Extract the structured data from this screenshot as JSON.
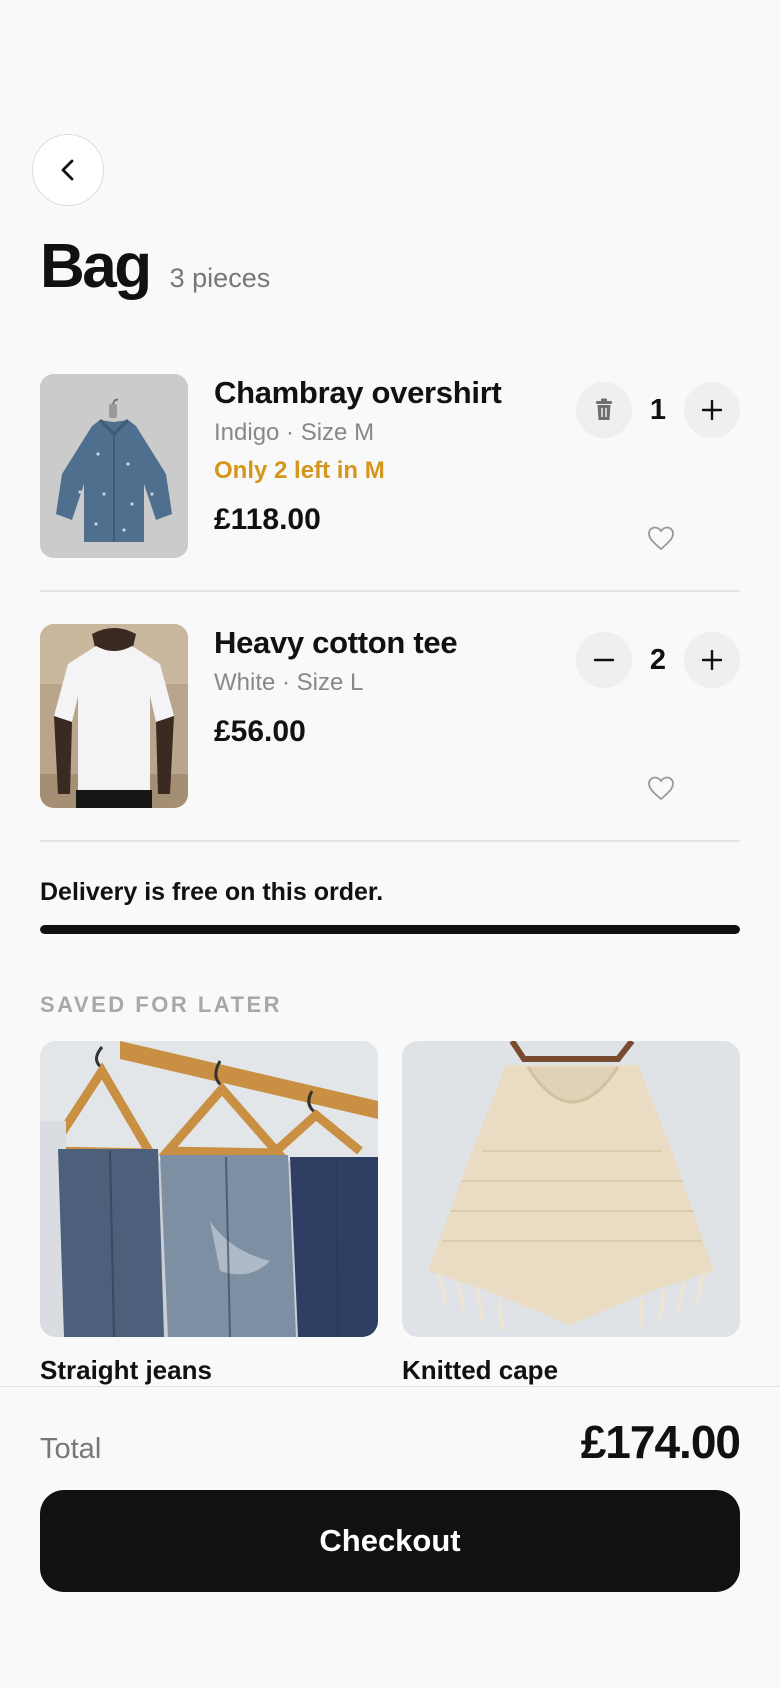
{
  "header": {
    "title": "Bag",
    "count": "3 pieces"
  },
  "bag_items": [
    {
      "name": "Chambray overshirt",
      "variant": "Indigo · Size M",
      "stock_note": "Only 2 left in M",
      "price": "£118.00",
      "quantity": "1",
      "image_icon": "denim-shirt-photo",
      "decrement_icon": "trash-icon",
      "increment_icon": "plus-icon",
      "favorite_icon": "heart-outline-icon"
    },
    {
      "name": "Heavy cotton tee",
      "variant": "White · Size L",
      "price": "£56.00",
      "quantity": "2",
      "image_icon": "white-tee-photo",
      "decrement_icon": "minus-icon",
      "increment_icon": "plus-icon",
      "favorite_icon": "heart-outline-icon"
    }
  ],
  "delivery": {
    "message": "Delivery is free on this order.",
    "progress_percent": 100
  },
  "saved": {
    "heading": "SAVED FOR LATER",
    "items": [
      {
        "name": "Straight jeans",
        "image_icon": "jeans-on-hangers-photo"
      },
      {
        "name": "Knitted cape",
        "image_icon": "knitted-cape-photo"
      }
    ]
  },
  "footer": {
    "total_label": "Total",
    "total_value": "£174.00",
    "checkout_label": "Checkout"
  },
  "colors": {
    "accent": "#111111",
    "warning": "#d4961c",
    "muted": "#777777",
    "background": "#f9f9f9"
  }
}
